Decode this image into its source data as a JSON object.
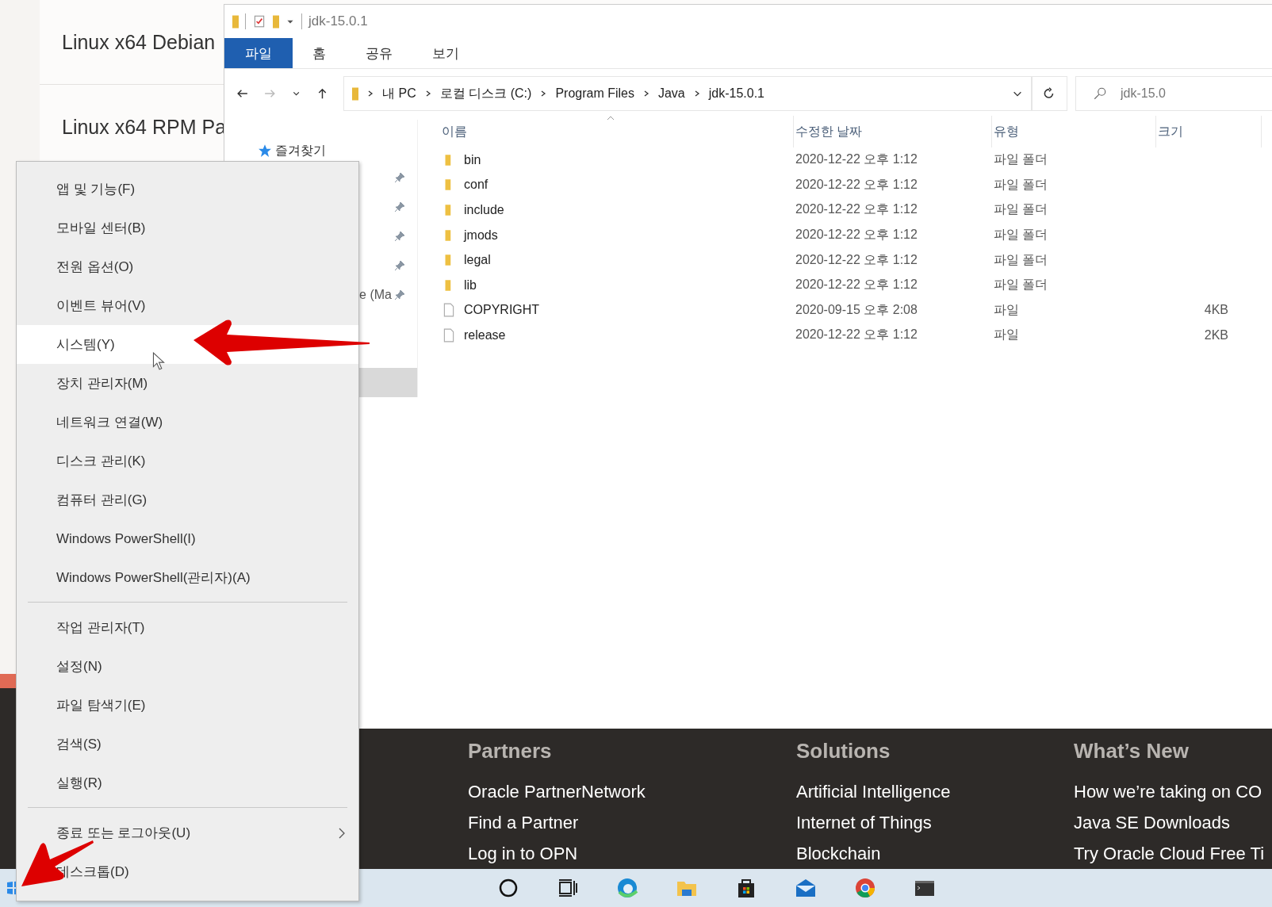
{
  "web_page": {
    "downloads": [
      "Linux x64 Debian",
      "Linux x64 RPM Pa"
    ],
    "footer": [
      {
        "heading": "Partners",
        "links": [
          "Oracle PartnerNetwork",
          "Find a Partner",
          "Log in to OPN"
        ]
      },
      {
        "heading": "Solutions",
        "links": [
          "Artificial Intelligence",
          "Internet of Things",
          "Blockchain"
        ]
      },
      {
        "heading": "What’s New",
        "links": [
          "How we’re taking on CO",
          "Java SE Downloads",
          "Try Oracle Cloud Free Ti"
        ]
      }
    ]
  },
  "explorer": {
    "title": "jdk-15.0.1",
    "tabs": [
      {
        "label": "파일",
        "selected": true
      },
      {
        "label": "홈",
        "selected": false
      },
      {
        "label": "공유",
        "selected": false
      },
      {
        "label": "보기",
        "selected": false
      }
    ],
    "breadcrumbs": [
      "내 PC",
      "로컬 디스크 (C:)",
      "Program Files",
      "Java",
      "jdk-15.0.1"
    ],
    "search": {
      "placeholder": "jdk-15.0"
    },
    "nav": {
      "header": "즐겨찾기",
      "rows": [
        {
          "pinned": true,
          "selected": false
        },
        {
          "pinned": true,
          "selected": false
        },
        {
          "pinned": true,
          "selected": false
        },
        {
          "pinned": true,
          "selected": false
        },
        {
          "label": "e (Ma",
          "pinned": true,
          "selected": false
        },
        {
          "pinned": false,
          "selected": false
        },
        {
          "pinned": false,
          "selected": false
        },
        {
          "pinned": false,
          "selected": true
        }
      ]
    },
    "columns": [
      "이름",
      "수정한 날짜",
      "유형",
      "크기"
    ],
    "files": [
      {
        "kind": "folder",
        "name": "bin",
        "date": "2020-12-22 오후 1:12",
        "type": "파일 폴더"
      },
      {
        "kind": "folder",
        "name": "conf",
        "date": "2020-12-22 오후 1:12",
        "type": "파일 폴더"
      },
      {
        "kind": "folder",
        "name": "include",
        "date": "2020-12-22 오후 1:12",
        "type": "파일 폴더"
      },
      {
        "kind": "folder",
        "name": "jmods",
        "date": "2020-12-22 오후 1:12",
        "type": "파일 폴더"
      },
      {
        "kind": "folder",
        "name": "legal",
        "date": "2020-12-22 오후 1:12",
        "type": "파일 폴더"
      },
      {
        "kind": "folder",
        "name": "lib",
        "date": "2020-12-22 오후 1:12",
        "type": "파일 폴더"
      },
      {
        "kind": "file",
        "name": "COPYRIGHT",
        "date": "2020-09-15 오후 2:08",
        "type": "파일",
        "size": "4KB"
      },
      {
        "kind": "file",
        "name": "release",
        "date": "2020-12-22 오후 1:12",
        "type": "파일",
        "size": "2KB"
      }
    ]
  },
  "context_menu": {
    "groups": [
      [
        {
          "label": "앱 및 기능(F)",
          "selected": false,
          "submenu": false
        },
        {
          "label": "모바일 센터(B)",
          "selected": false,
          "submenu": false
        },
        {
          "label": "전원 옵션(O)",
          "selected": false,
          "submenu": false
        },
        {
          "label": "이벤트 뷰어(V)",
          "selected": false,
          "submenu": false
        },
        {
          "label": "시스템(Y)",
          "selected": true,
          "submenu": false
        },
        {
          "label": "장치 관리자(M)",
          "selected": false,
          "submenu": false
        },
        {
          "label": "네트워크 연결(W)",
          "selected": false,
          "submenu": false
        },
        {
          "label": "디스크 관리(K)",
          "selected": false,
          "submenu": false
        },
        {
          "label": "컴퓨터 관리(G)",
          "selected": false,
          "submenu": false
        },
        {
          "label": "Windows PowerShell(I)",
          "selected": false,
          "submenu": false
        },
        {
          "label": "Windows PowerShell(관리자)(A)",
          "selected": false,
          "submenu": false
        }
      ],
      [
        {
          "label": "작업 관리자(T)",
          "selected": false,
          "submenu": false
        },
        {
          "label": "설정(N)",
          "selected": false,
          "submenu": false
        },
        {
          "label": "파일 탐색기(E)",
          "selected": false,
          "submenu": false
        },
        {
          "label": "검색(S)",
          "selected": false,
          "submenu": false
        },
        {
          "label": "실행(R)",
          "selected": false,
          "submenu": false
        }
      ],
      [
        {
          "label": "종료 또는 로그아웃(U)",
          "selected": false,
          "submenu": true
        },
        {
          "label": "데스크톱(D)",
          "selected": false,
          "submenu": false
        }
      ]
    ]
  },
  "taskbar": {
    "apps": [
      {
        "kind": "search"
      },
      {
        "kind": "taskview"
      },
      {
        "kind": "edge"
      },
      {
        "kind": "folder"
      },
      {
        "kind": "store"
      },
      {
        "kind": "mail"
      },
      {
        "kind": "chrome"
      },
      {
        "kind": "terminal"
      }
    ]
  }
}
